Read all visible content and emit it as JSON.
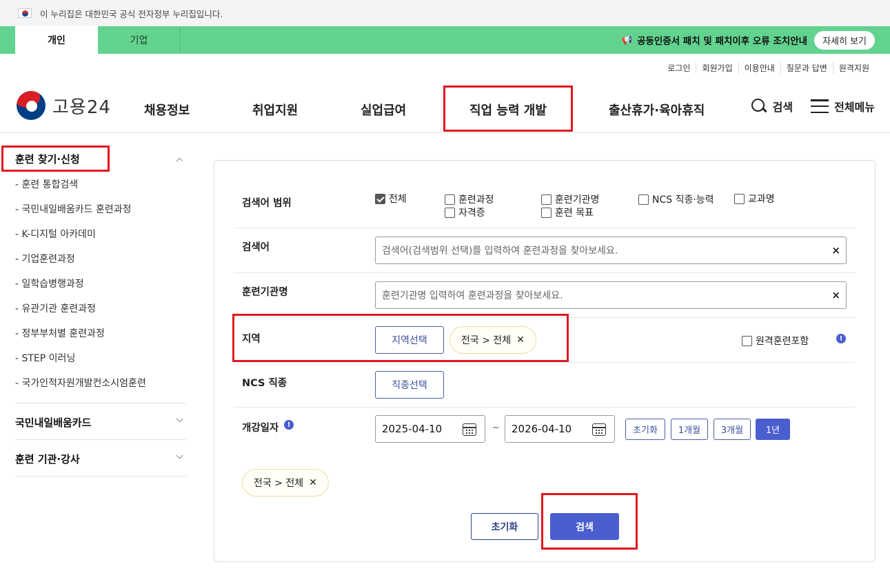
{
  "gov_banner": {
    "text": "이 누리집은 대한민국 공식 전자정부 누리집입니다."
  },
  "tabbar": {
    "tabs": [
      "개인",
      "기업"
    ],
    "notice": "공동인증서 패치 및 패치이후 오류 조치안내",
    "more_label": "자세히 보기"
  },
  "util_links": [
    "로그인",
    "회원가입",
    "이용안내",
    "질문과 답변",
    "원격지원"
  ],
  "header": {
    "logo_text": "고용24",
    "menu": [
      "채용정보",
      "취업지원",
      "실업급여",
      "직업 능력 개발",
      "출산휴가·육아휴직"
    ],
    "search_label": "검색",
    "all_menu_label": "전체메뉴"
  },
  "sidebar": {
    "section1": "훈련 찾기·신청",
    "items": [
      "- 훈련 통합검색",
      "- 국민내일배움카드 훈련과정",
      "- K-디지털 아카데미",
      "- 기업훈련과정",
      "- 일학습병행과정",
      "- 유관기관 훈련과정",
      "- 정부부처별 훈련과정",
      "- STEP 이러닝",
      "- 국가인적자원개발컨소시엄훈련"
    ],
    "section2": "국민내일배움카드",
    "section3": "훈련 기관·강사"
  },
  "form": {
    "scope_label": "검색어 범위",
    "scope_options": [
      {
        "label": "전체",
        "checked": true
      },
      {
        "label": "훈련과정",
        "checked": false
      },
      {
        "label": "훈련기관명",
        "checked": false
      },
      {
        "label": "NCS 직종·능력",
        "checked": false
      },
      {
        "label": "교과명",
        "checked": false
      },
      {
        "label": "자격증",
        "checked": false
      },
      {
        "label": "훈련 목표",
        "checked": false
      }
    ],
    "keyword_label": "검색어",
    "keyword_placeholder": "검색어(검색범위 선택)를 입력하여 훈련과정을 찾아보세요.",
    "org_label": "훈련기관명",
    "org_placeholder": "훈련기관명 입력하여 훈련과정을 찾아보세요.",
    "region_label": "지역",
    "region_button": "지역선택",
    "region_chip": "전국 > 전체",
    "remote_label": "원격훈련포함",
    "ncs_label": "NCS 직종",
    "ncs_button": "직종선택",
    "date_label": "개강일자",
    "date_from": "2025-04-10",
    "date_sep": "~",
    "date_to": "2026-04-10",
    "period_buttons": [
      "초기화",
      "1개월",
      "3개월",
      "1년"
    ],
    "selected_chip": "전국 > 전체",
    "reset_label": "초기화",
    "search_label": "검색"
  },
  "colors": {
    "green": "#62d28f",
    "primary": "#4a5ed0",
    "highlight_red": "#e0181f"
  }
}
